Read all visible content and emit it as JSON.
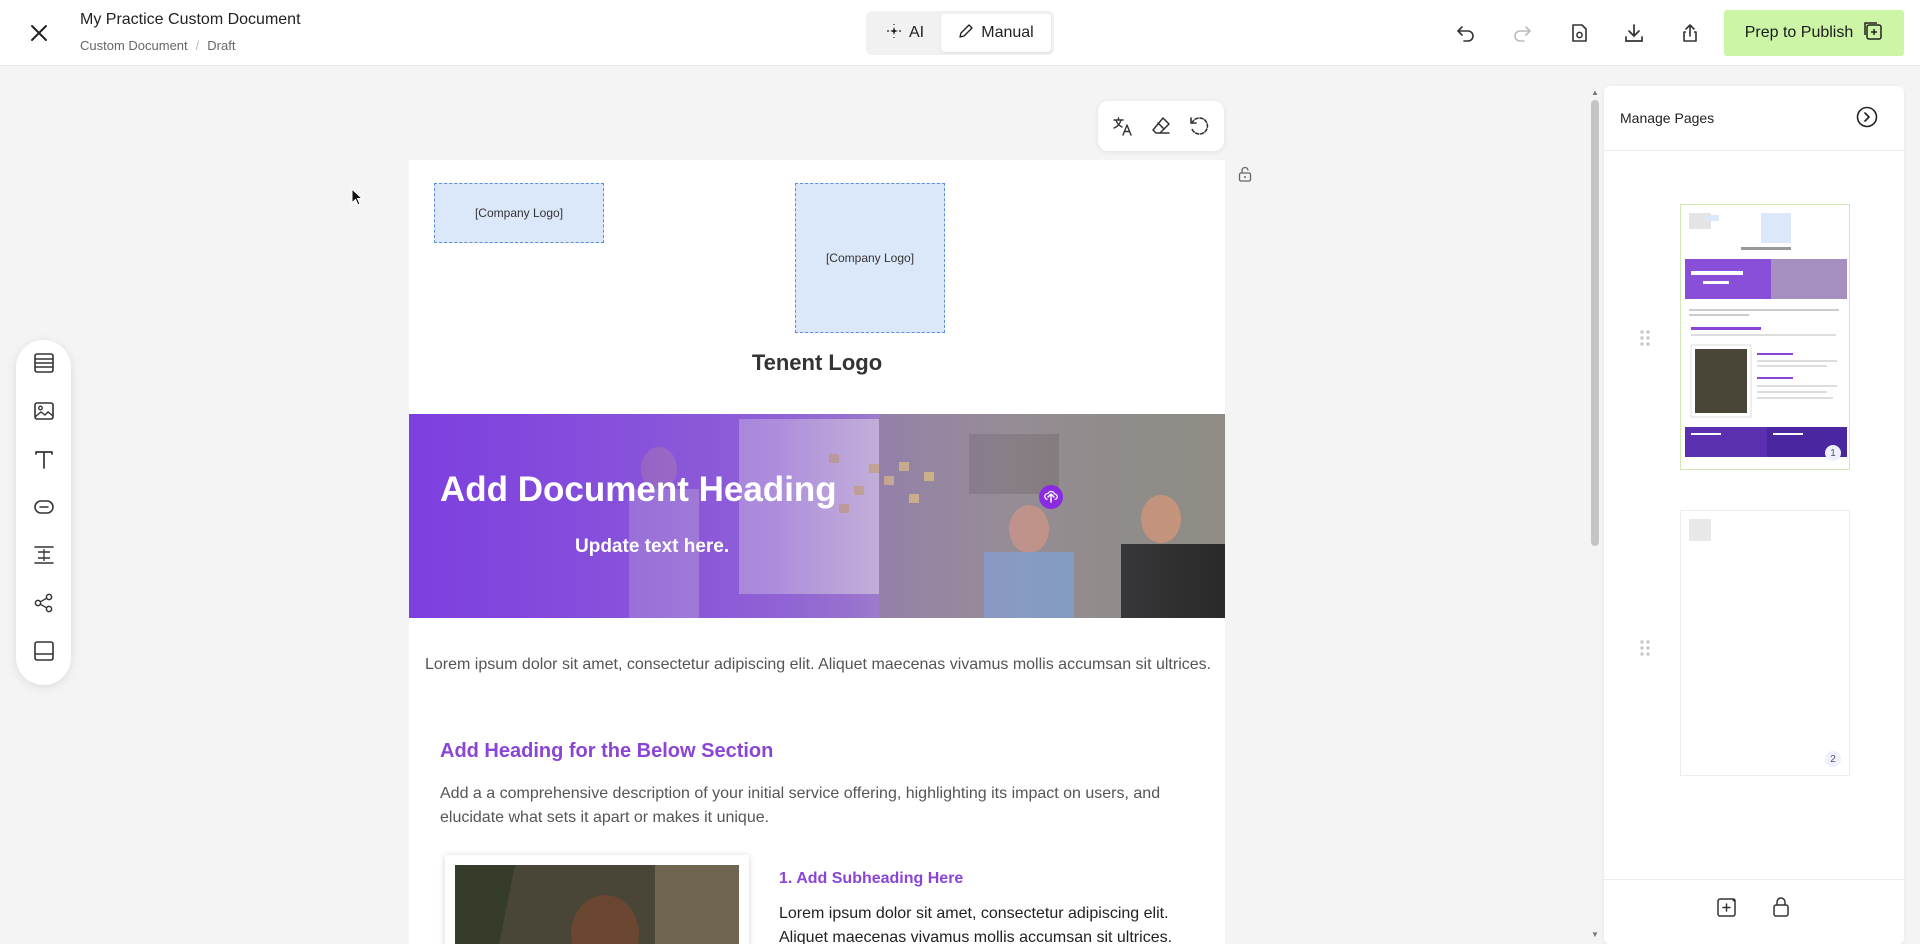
{
  "header": {
    "doc_title": "My Practice Custom Document",
    "breadcrumb": [
      "Custom Document",
      "Draft"
    ],
    "modes": {
      "ai": "AI",
      "manual": "Manual",
      "active": "Manual"
    },
    "publish_label": "Prep to Publish",
    "icons": [
      "close-icon",
      "undo-icon",
      "redo-icon",
      "preview-icon",
      "download-icon",
      "share-icon",
      "publish-icon"
    ]
  },
  "palette": {
    "icons": [
      "table-icon",
      "image-icon",
      "text-icon",
      "button-icon",
      "spacer-icon",
      "social-icon",
      "footer-icon"
    ]
  },
  "canvas_tools": [
    "translate-icon",
    "eraser-icon",
    "reset-icon"
  ],
  "document": {
    "logo_placeholder_1": "[Company Logo]",
    "logo_placeholder_2": "[Company Logo]",
    "tenant_logo": "Tenent Logo",
    "banner_heading": "Add Document Heading",
    "banner_sub": "Update text here.",
    "intro": "Lorem ipsum dolor sit amet, consectetur adipiscing elit. Aliquet maecenas vivamus mollis accumsan sit ultrices.",
    "section_heading": "Add Heading for the Below Section",
    "section_desc": "Add a a comprehensive description of your initial service offering, highlighting its impact on users, and elucidate what sets it apart or makes it unique.",
    "subheading": "1. Add Subheading Here",
    "sub_text": "Lorem ipsum dolor sit amet, consectetur adipiscing elit. Aliquet maecenas vivamus mollis accumsan sit ultrices."
  },
  "right_panel": {
    "title": "Manage Pages",
    "pages": [
      {
        "number": "1",
        "heading": "Add Document Heading"
      },
      {
        "number": "2"
      }
    ]
  },
  "colors": {
    "accent_purple": "#8a45d6",
    "publish_green": "#cdf5a6",
    "logo_fill": "#dbe8f9"
  }
}
